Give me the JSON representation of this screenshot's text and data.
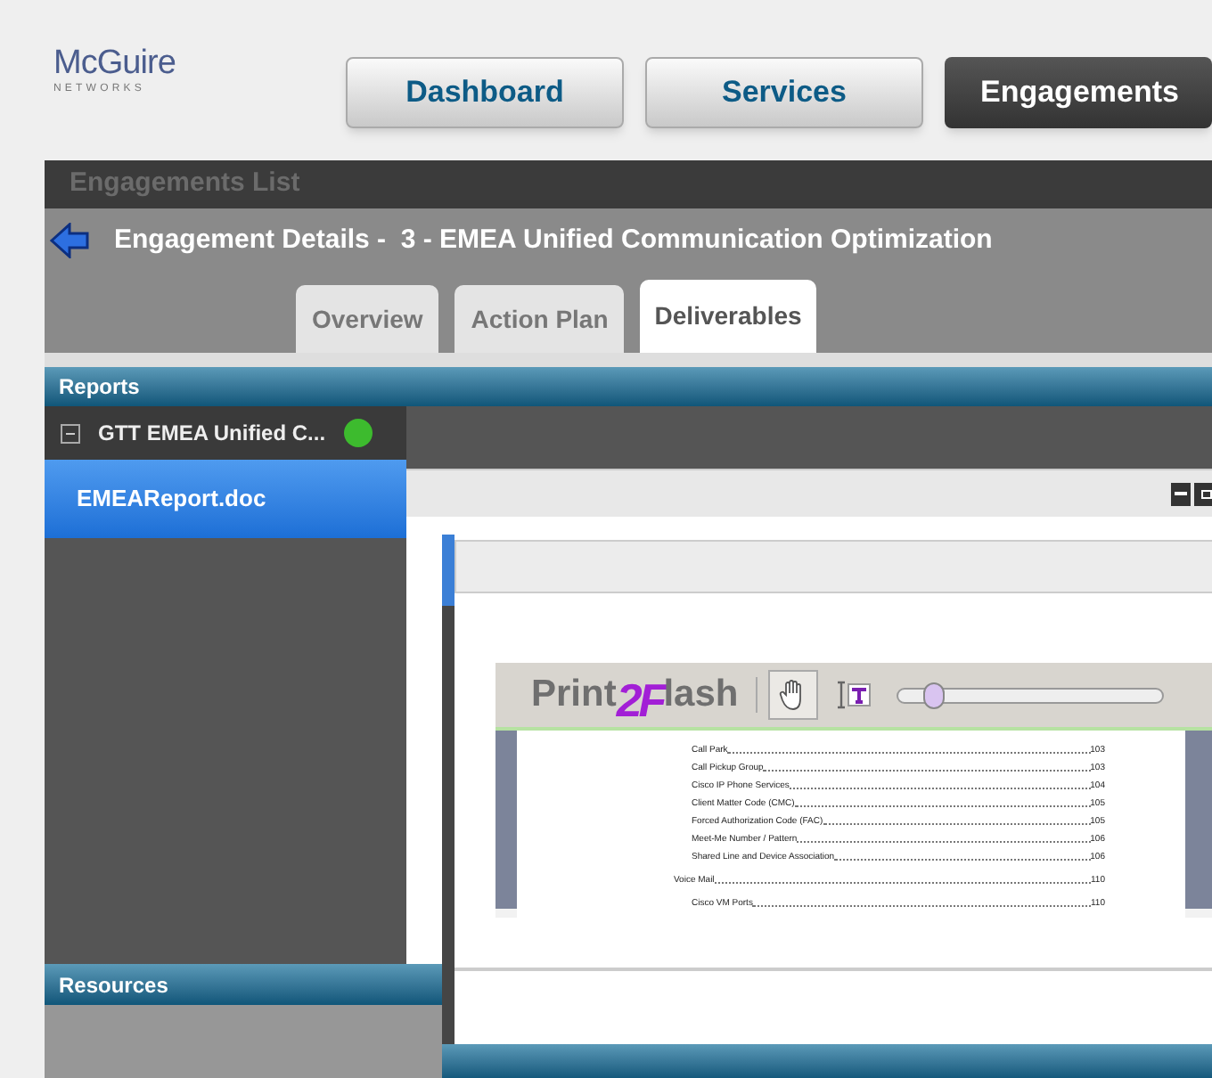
{
  "logo": {
    "name": "McGuire",
    "tagline": "NETWORKS"
  },
  "nav": [
    {
      "label": "Dashboard",
      "selected": false
    },
    {
      "label": "Services",
      "selected": false
    },
    {
      "label": "Engagements",
      "selected": true
    }
  ],
  "breadcrumb": "Engagements List",
  "details_title": "Engagement Details -  3 - EMEA Unified Communication Optimization",
  "tabs": [
    {
      "label": "Overview",
      "selected": false
    },
    {
      "label": "Action Plan",
      "selected": false
    },
    {
      "label": "Deliverables",
      "selected": true
    }
  ],
  "reports": {
    "title": "Reports",
    "tree": {
      "label": "GTT EMEA Unified C...",
      "expanded": true,
      "color": "#3dbb2e",
      "children": [
        {
          "label": "EMEAReport.doc",
          "selected": true
        }
      ]
    }
  },
  "resources": {
    "title": "Resources"
  },
  "viewer": {
    "logo": [
      "Print",
      "2F",
      "lash"
    ],
    "tools": [
      {
        "kind": "hand",
        "selected": true
      },
      {
        "kind": "text",
        "selected": false
      }
    ],
    "zoom": {
      "level": 0.1
    },
    "toc": [
      {
        "kind": "sub",
        "title": "Call Park",
        "page": "103"
      },
      {
        "kind": "sub",
        "title": "Call Pickup Group",
        "page": "103"
      },
      {
        "kind": "sub",
        "title": "Cisco IP Phone Services",
        "page": "104"
      },
      {
        "kind": "sub",
        "title": "Client Matter Code (CMC)",
        "page": "105"
      },
      {
        "kind": "sub",
        "title": "Forced Authorization Code (FAC)",
        "page": "105"
      },
      {
        "kind": "sub",
        "title": "Meet-Me Number / Pattern",
        "page": "106"
      },
      {
        "kind": "sub",
        "title": "Shared Line and Device Association",
        "page": "106"
      },
      {
        "kind": "section",
        "title": "Voice Mail",
        "page": "110"
      },
      {
        "kind": "sub",
        "title": "Cisco VM Ports",
        "page": "110"
      }
    ]
  }
}
